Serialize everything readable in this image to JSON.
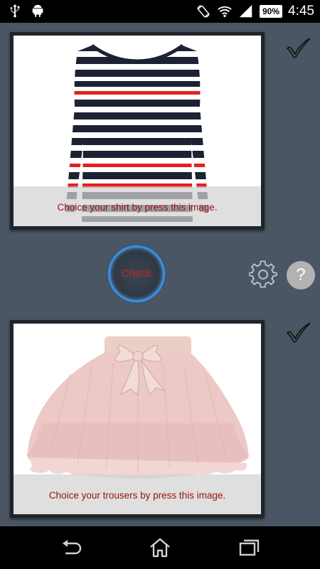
{
  "status_bar": {
    "battery_percent": "90%",
    "time": "4:45",
    "icons": [
      "usb-icon",
      "android-icon",
      "rotate-icon",
      "wifi-icon",
      "signal-icon",
      "battery-icon"
    ]
  },
  "shirt_card": {
    "caption": "Choice your shirt by press this image.",
    "image_name": "striped-shirt-image",
    "selected": true
  },
  "controls": {
    "check_label": "Check",
    "help_label": "?"
  },
  "trousers_card": {
    "caption": "Choice your trousers by press this image.",
    "image_name": "pink-tutu-skirt-image",
    "selected": true
  },
  "nav_bar": {
    "items": [
      "back-icon",
      "home-icon",
      "recent-apps-icon"
    ]
  },
  "colors": {
    "background": "#4a5663",
    "caption_text": "#9b1010",
    "check_ring": "#3d8fe0",
    "check_text": "#c8232a"
  }
}
